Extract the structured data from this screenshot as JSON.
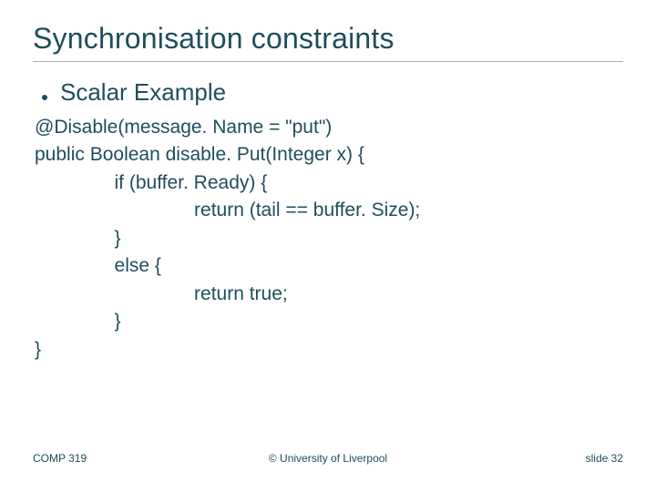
{
  "title": "Synchronisation constraints",
  "bullet": "Scalar Example",
  "code": {
    "l1": "@Disable(message. Name = \"put\")",
    "l2": "public Boolean disable. Put(Integer x) {",
    "l3": "               if (buffer. Ready) {",
    "l4": "                              return (tail == buffer. Size);",
    "l5": "               }",
    "l6": "               else {",
    "l7": "                              return true;",
    "l8": "               }",
    "l9": "}"
  },
  "footer": {
    "left": "COMP 319",
    "center": "© University of Liverpool",
    "right": "slide  32"
  }
}
